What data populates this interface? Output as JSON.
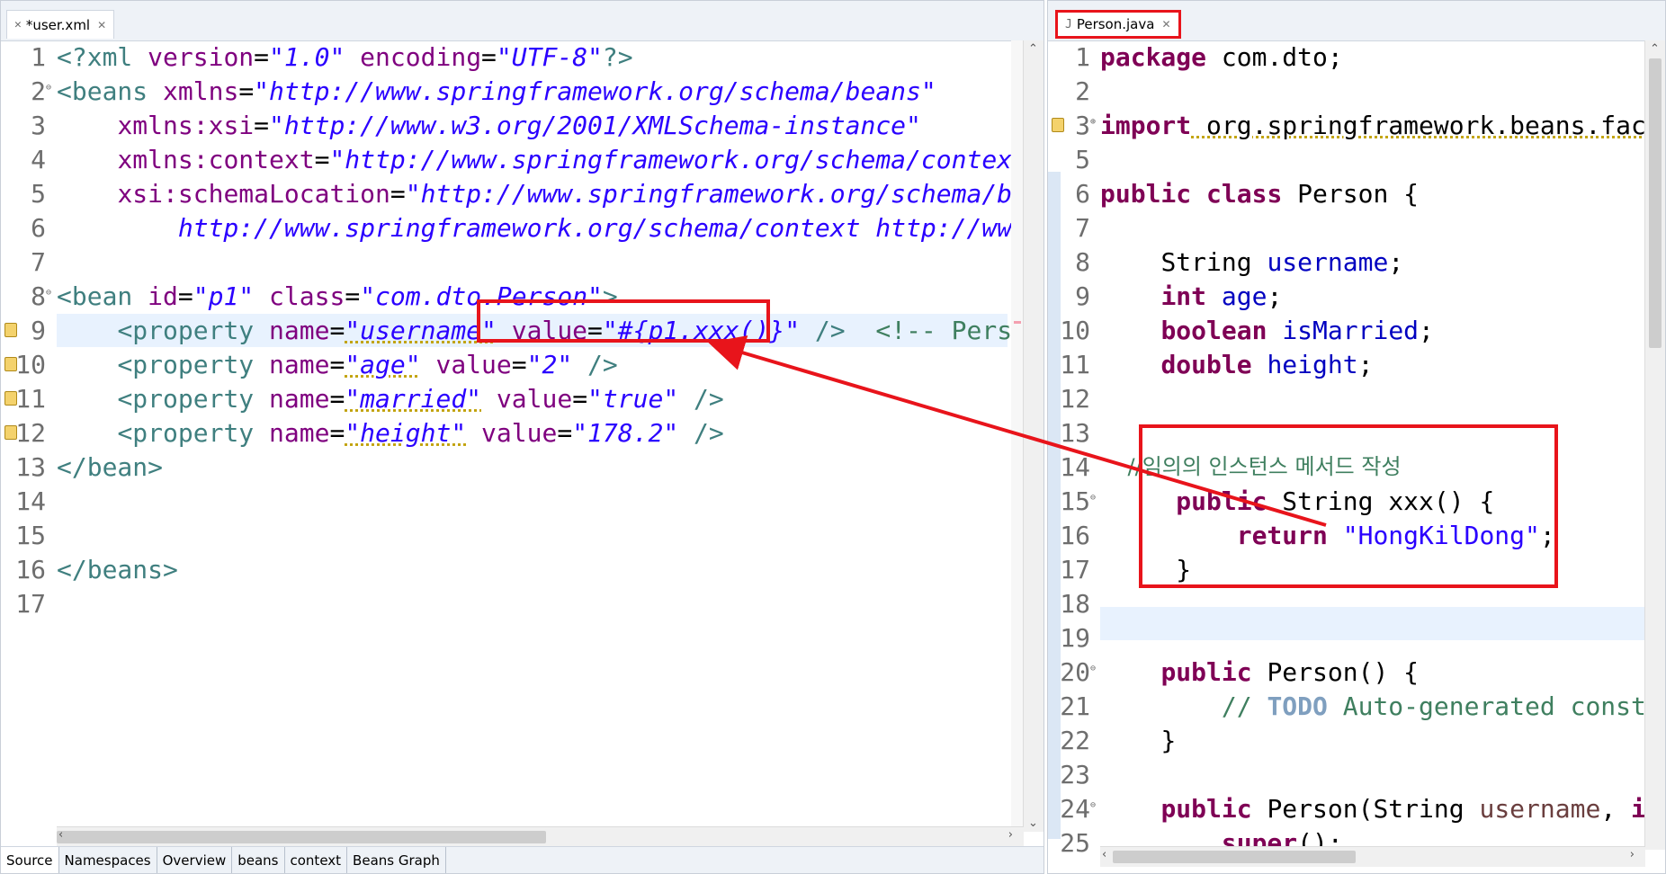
{
  "left_editor": {
    "tab_label": "*user.xml",
    "tab_icon": "xml-file-icon",
    "lines": [
      {
        "n": "1"
      },
      {
        "n": "2"
      },
      {
        "n": "3"
      },
      {
        "n": "4"
      },
      {
        "n": "5"
      },
      {
        "n": "6"
      },
      {
        "n": "7"
      },
      {
        "n": "8"
      },
      {
        "n": "9"
      },
      {
        "n": "10"
      },
      {
        "n": "11"
      },
      {
        "n": "12"
      },
      {
        "n": "13"
      },
      {
        "n": "14"
      },
      {
        "n": "15"
      },
      {
        "n": "16"
      },
      {
        "n": "17"
      }
    ],
    "tokens": {
      "l1_a": "<?xml ",
      "l1_b": "version",
      "l1_c": "=",
      "l1_d": "\"1.0\"",
      "l1_e": " encoding",
      "l1_f": "=",
      "l1_g": "\"UTF-8\"",
      "l1_h": "?>",
      "l2_a": "<beans ",
      "l2_b": "xmlns",
      "l2_c": "=",
      "l2_d": "\"http://www.springframework.org/schema/beans\"",
      "l3_a": "xmlns:xsi",
      "l3_b": "=",
      "l3_c": "\"http://www.w3.org/2001/XMLSchema-instance\"",
      "l4_a": "xmlns:context",
      "l4_b": "=",
      "l4_c": "\"http://www.springframework.org/schema/context\"",
      "l5_a": "xsi:schemaLocation",
      "l5_b": "=",
      "l5_c": "\"http://www.springframework.org/schema/bean",
      "l6_a": "http://www.springframework.org/schema/context http://www.sp",
      "l8_a": "<bean ",
      "l8_b": "id",
      "l8_c": "=",
      "l8_d": "\"p1\"",
      "l8_e": " class",
      "l8_f": "=",
      "l8_g": "\"com.dto.Person\"",
      "l8_h": ">",
      "l9_a": "<property ",
      "l9_b": "name",
      "l9_c": "=",
      "l9_d": "\"username\"",
      "l9_e": " value",
      "l9_f": "=",
      "l9_g": "\"#{p1.xxx()}\"",
      "l9_h": " />",
      "l9_i": "  <!-- Person(",
      "l10_a": "<property ",
      "l10_b": "name",
      "l10_c": "=",
      "l10_d": "\"age\"",
      "l10_e": " value",
      "l10_f": "=",
      "l10_g": "\"2\"",
      "l10_h": " />",
      "l11_a": "<property ",
      "l11_b": "name",
      "l11_c": "=",
      "l11_d": "\"married\"",
      "l11_e": " value",
      "l11_f": "=",
      "l11_g": "\"true\"",
      "l11_h": " />",
      "l12_a": "<property ",
      "l12_b": "name",
      "l12_c": "=",
      "l12_d": "\"height\"",
      "l12_e": " value",
      "l12_f": "=",
      "l12_g": "\"178.2\"",
      "l12_h": " />",
      "l13_a": "</bean>",
      "l16_a": "</beans>"
    },
    "bottom_tabs": [
      "Source",
      "Namespaces",
      "Overview",
      "beans",
      "context",
      "Beans Graph"
    ]
  },
  "right_editor": {
    "tab_label": "Person.java",
    "tab_icon": "java-file-icon",
    "lines": [
      {
        "n": "1"
      },
      {
        "n": "2"
      },
      {
        "n": "3"
      },
      {
        "n": "5"
      },
      {
        "n": "6"
      },
      {
        "n": "7"
      },
      {
        "n": "8"
      },
      {
        "n": "9"
      },
      {
        "n": "10"
      },
      {
        "n": "11"
      },
      {
        "n": "12"
      },
      {
        "n": "13"
      },
      {
        "n": "14"
      },
      {
        "n": "15"
      },
      {
        "n": "16"
      },
      {
        "n": "17"
      },
      {
        "n": "18"
      },
      {
        "n": "19"
      },
      {
        "n": "20"
      },
      {
        "n": "21"
      },
      {
        "n": "22"
      },
      {
        "n": "23"
      },
      {
        "n": "24"
      },
      {
        "n": "25"
      }
    ],
    "tokens": {
      "r1_a": "package",
      "r1_b": " com.dto;",
      "r3_a": "import",
      "r3_b": " org.springframework.beans.fact",
      "r6_a": "public",
      "r6_b": " ",
      "r6_c": "class",
      "r6_d": " Person {",
      "r8_a": "String ",
      "r8_b": "username",
      "r8_c": ";",
      "r9_a": "int",
      "r9_b": " ",
      "r9_c": "age",
      "r9_d": ";",
      "r10_a": "boolean",
      "r10_b": " ",
      "r10_c": "isMarried",
      "r10_d": ";",
      "r11_a": "double",
      "r11_b": " ",
      "r11_c": "height",
      "r11_d": ";",
      "r14_a": "//임의의 인스턴스 메서드 작성",
      "r15_a": "public",
      "r15_b": " String xxx() {",
      "r16_a": "return",
      "r16_b": " ",
      "r16_c": "\"HongKilDong\"",
      "r16_d": ";",
      "r17_a": "}",
      "r20_a": "public",
      "r20_b": " Person() {",
      "r21_a": "// ",
      "r21_b": "TODO",
      "r21_c": " Auto-generated constr",
      "r22_a": "}",
      "r24_a": "public",
      "r24_b": " Person(String ",
      "r24_c": "username",
      "r24_d": ", ",
      "r24_e": "in",
      "r25_a": "super",
      "r25_b": "();"
    }
  },
  "colors": {
    "highlight": "#e8141b",
    "xml_tag": "#3f7f7f",
    "xml_attr": "#7f007f",
    "string": "#2a00ff",
    "keyword": "#7f0055"
  }
}
